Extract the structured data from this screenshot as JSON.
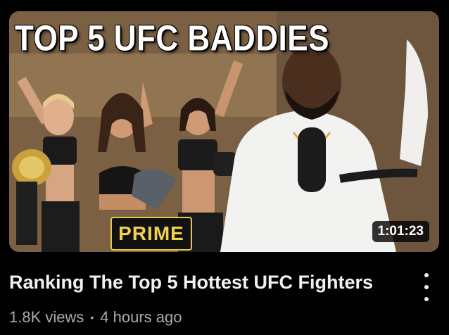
{
  "video": {
    "thumbnail_text": "TOP 5 UFC BADDIES",
    "thumbnail_brand": "PRIME",
    "duration": "1:01:23",
    "title": "Ranking The Top 5 Hottest UFC Fighters",
    "views": "1.8K views",
    "separator": "•",
    "age": "4 hours ago"
  },
  "icons": {
    "menu": "more-vert-icon"
  },
  "colors": {
    "background": "#000000",
    "title": "#f1f1f1",
    "meta": "#aaaaaa",
    "prime_gold": "#f2d14a"
  }
}
